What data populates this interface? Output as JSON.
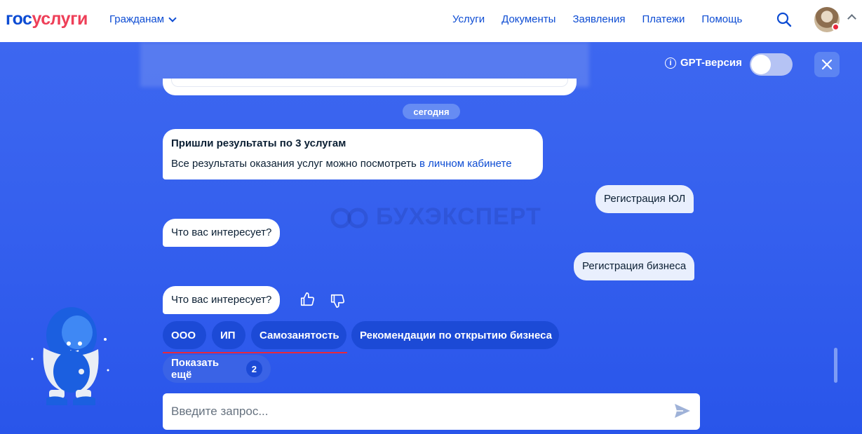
{
  "header": {
    "logo_part1": "гос",
    "logo_part2": "услуги",
    "audience": "Гражданам",
    "nav": [
      "Услуги",
      "Документы",
      "Заявления",
      "Платежи",
      "Помощь"
    ]
  },
  "chat": {
    "gpt_label": "GPT-версия",
    "gpt_toggle_on": false,
    "date_badge": "сегодня",
    "messages": [
      {
        "role": "bot",
        "title": "Пришли результаты по 3 услугам",
        "text": "Все результаты оказания услуг можно посмотреть ",
        "link": "в личном кабинете"
      },
      {
        "role": "user",
        "text": "Регистрация ЮЛ"
      },
      {
        "role": "bot",
        "text": "Что вас интересует?"
      },
      {
        "role": "user",
        "text": "Регистрация бизнеса"
      },
      {
        "role": "bot",
        "text": "Что вас интересует?"
      }
    ],
    "options": [
      "ООО",
      "ИП",
      "Самозанятость",
      "Рекомендации по открытию бизнеса"
    ],
    "show_more": {
      "label": "Показать ещё",
      "count": "2"
    },
    "input_placeholder": "Введите запрос...",
    "watermark": "БУХЭКСПЕРТ"
  },
  "colors": {
    "brand_blue": "#0d4cd3",
    "brand_red": "#ee3f58",
    "panel_bg": "#3560ee",
    "chip_bg": "#1c4ad6",
    "underline": "#e8283c"
  }
}
